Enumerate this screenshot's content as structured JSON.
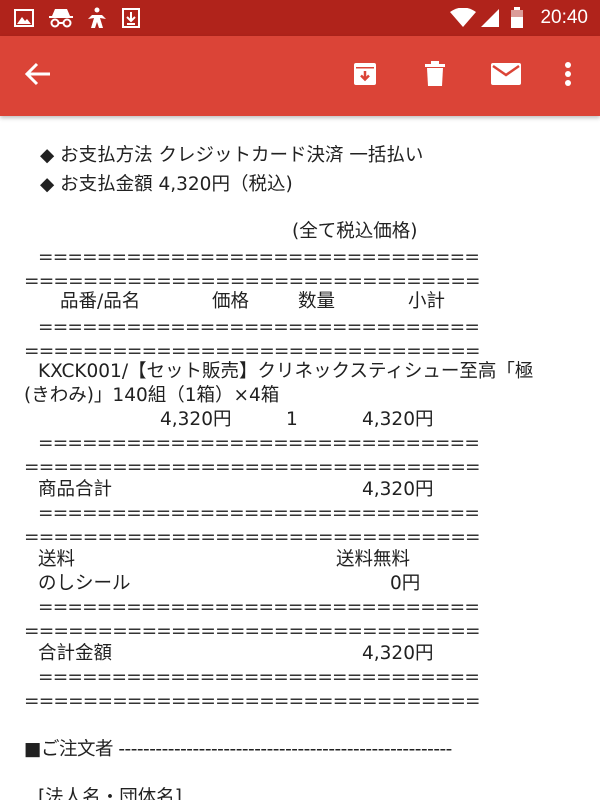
{
  "status_bar": {
    "time": "20:40",
    "left_icons": [
      "image-icon",
      "incognito-icon",
      "person-walking-icon",
      "download-icon"
    ],
    "right_icons": [
      "wifi-icon",
      "signal-icon",
      "battery-icon"
    ]
  },
  "app_bar": {
    "color": "#db4437",
    "actions": [
      "back-arrow-icon",
      "archive-icon",
      "delete-icon",
      "mail-icon",
      "more-vert-icon"
    ]
  },
  "email_body": {
    "payment_method": "◆ お支払方法 クレジットカード決済 一括払い",
    "payment_amount": "◆ お支払金額 4,320円（税込)",
    "tax_note": "(全て税込価格)",
    "sep_short": "==============================",
    "sep_long": "===============================",
    "headers": {
      "product": "品番/品名",
      "price": "価格",
      "qty": "数量",
      "subtotal": "小計"
    },
    "item": {
      "name_line1": "KXCK001/【セット販売】クリネックスティシュー至高「極",
      "name_line2": "(きわみ)」140組（1箱）×4箱",
      "price": "4,320円",
      "qty": "1",
      "subtotal": "4,320円"
    },
    "product_total_label": "商品合計",
    "product_total_value": "4,320円",
    "shipping_label": "送料",
    "shipping_value": "送料無料",
    "noshi_label": "のしシール",
    "noshi_value": "0円",
    "grand_total_label": "合計金額",
    "grand_total_value": "4,320円",
    "orderer_heading": "■ご注文者 ------------------------------------------------------",
    "company_label": "[法人名・団体名]"
  }
}
